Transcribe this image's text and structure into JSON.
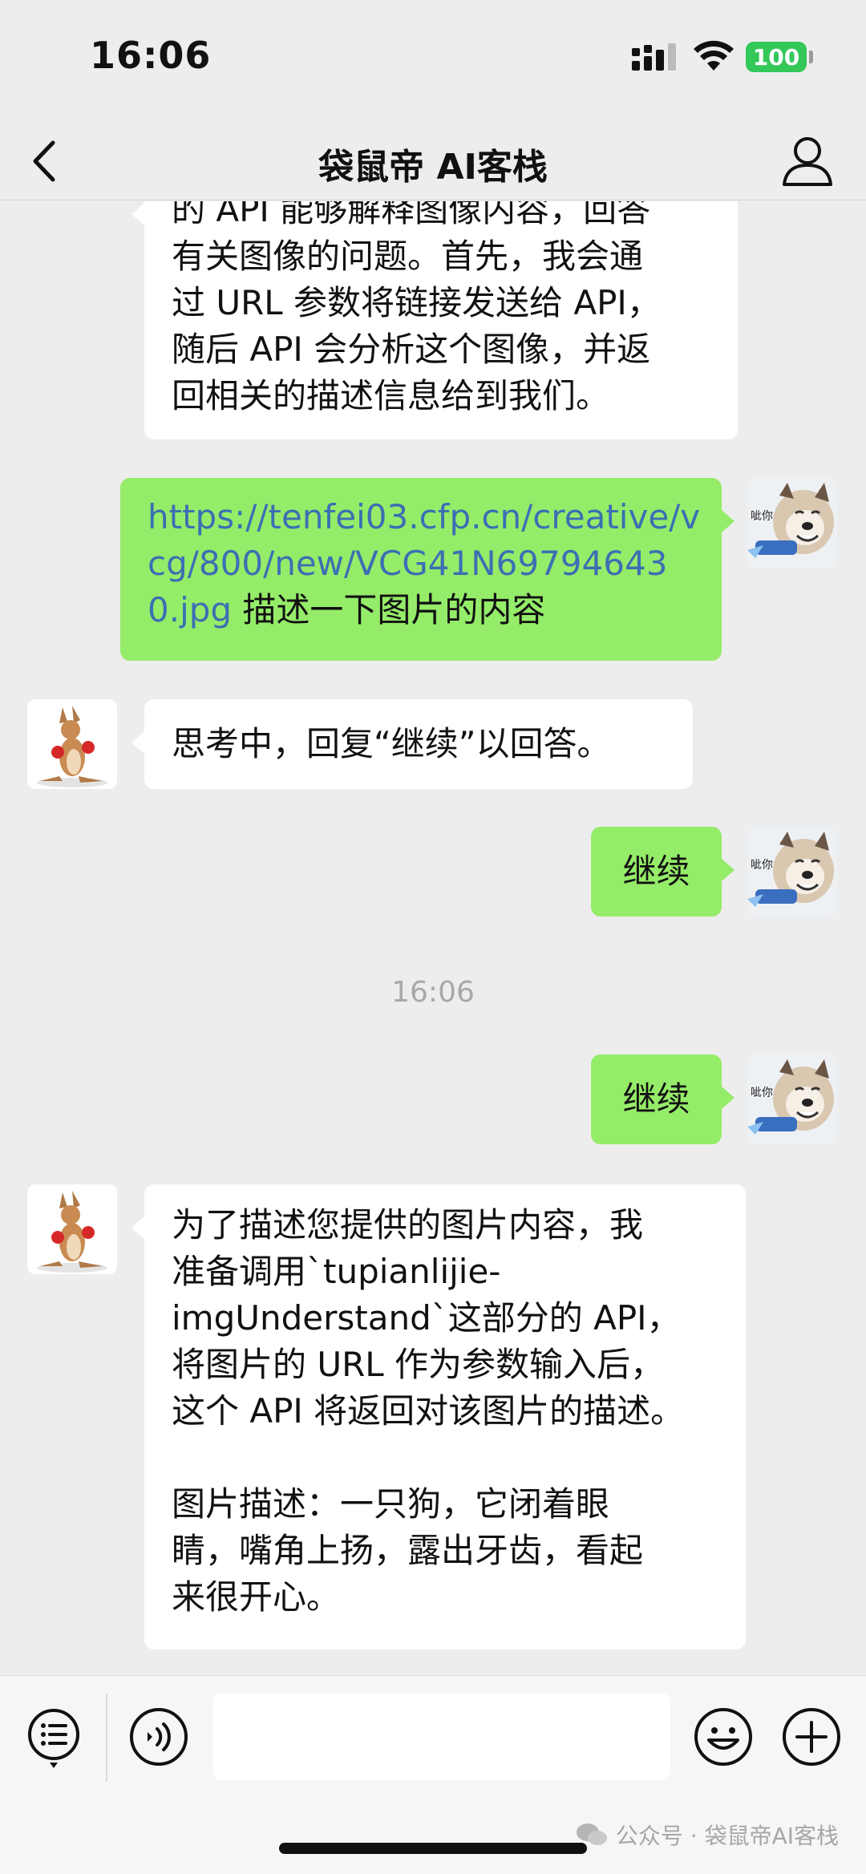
{
  "status_bar": {
    "time": "16:06",
    "battery": "100"
  },
  "nav": {
    "title": "袋鼠帝 AI客栈"
  },
  "messages": {
    "m1": {
      "lines": [
        "的 API 能够解释图像内容，回答",
        "有关图像的问题。首先，我会通",
        "过 URL 参数将链接发送给 API，",
        "随后 API 会分析这个图像，并返",
        "回相关的描述信息给到我们。"
      ]
    },
    "m2": {
      "link_line1": "https://tenfei03.cfp.cn/creative/v",
      "link_line2": "cg/800/new/VCG41N69794643",
      "link_line3": "0.jpg",
      "text_after": " 描述一下图片的内容"
    },
    "m3": {
      "text": "思考中，回复“继续”以回答。"
    },
    "m4": {
      "text": "继续"
    },
    "timestamp": "16:06",
    "m5": {
      "text": "继续"
    },
    "m6": {
      "lines": [
        "为了描述您提供的图片内容，我",
        "准备调用`tupianlijie-",
        "imgUnderstand`这部分的 API，",
        "将图片的 URL 作为参数输入后，",
        "这个 API 将返回对该图片的描述。"
      ],
      "lines2": [
        "图片描述：一只狗，它闭着眼",
        "睛，嘴角上扬，露出牙齿，看起",
        "来很开心。"
      ]
    }
  },
  "avatars": {
    "user_caption": "呲你"
  },
  "input": {
    "value": ""
  },
  "watermark": "公众号 · 袋鼠帝AI客栈",
  "colors": {
    "user_bubble": "#95ec69",
    "bot_bubble": "#ffffff",
    "background": "#ededed",
    "link": "#3b6fb3"
  }
}
